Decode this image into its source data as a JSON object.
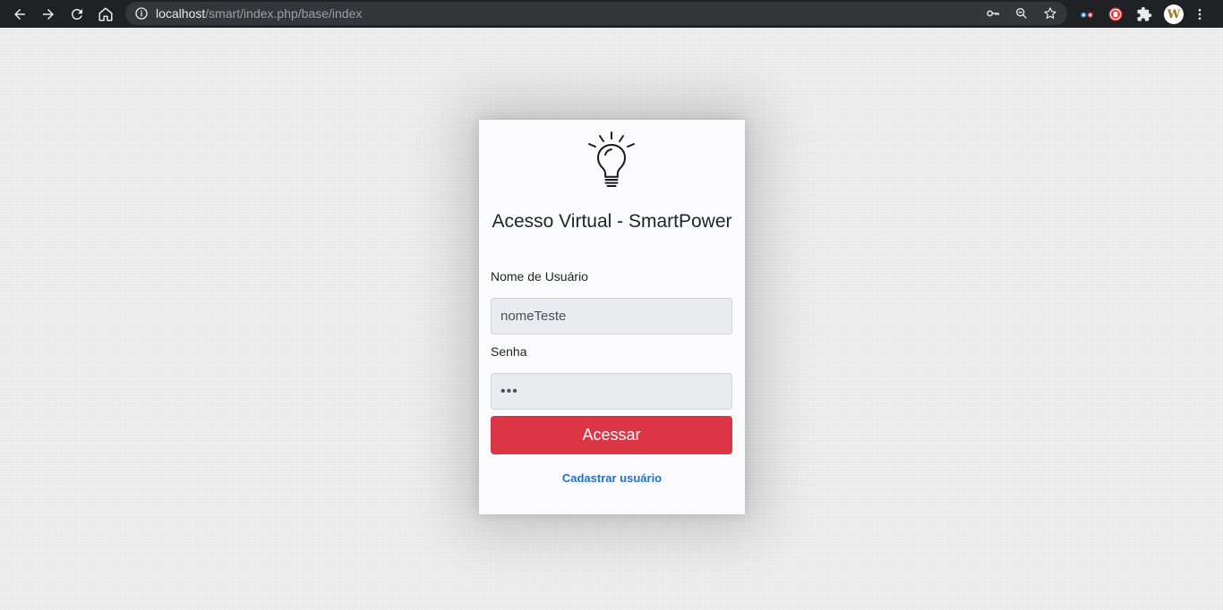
{
  "browser": {
    "url_host": "localhost",
    "url_path": "/smart/index.php/base/index",
    "profile_initial": "W"
  },
  "login": {
    "title": "Acesso Virtual - SmartPower",
    "username_label": "Nome de Usuário",
    "username_value": "nomeTeste",
    "password_label": "Senha",
    "password_value": "•••",
    "submit_label": "Acessar",
    "register_link": "Cadastrar usuário"
  },
  "colors": {
    "primary_button": "#dc3545",
    "link": "#1e73c5",
    "card_background": "#fbfbfd"
  }
}
